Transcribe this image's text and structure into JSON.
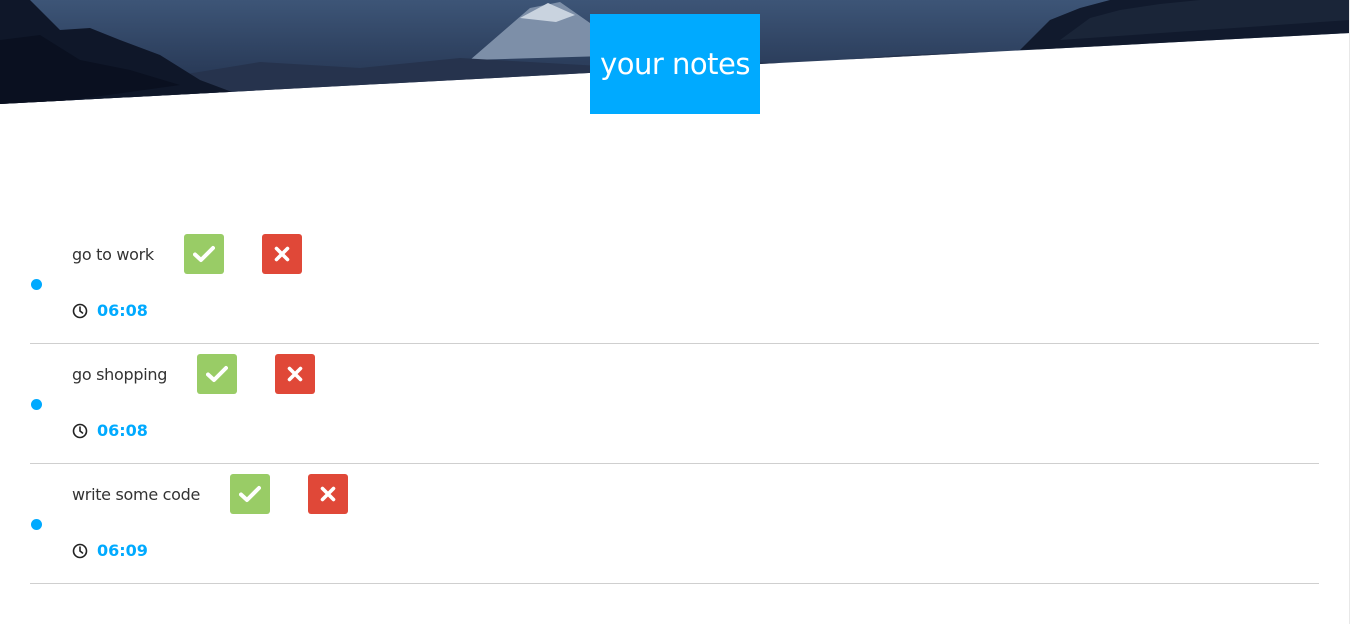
{
  "header": {
    "title": "your notes",
    "title_bg": "#00aaff",
    "background_image": "mountain-landscape"
  },
  "colors": {
    "accent": "#00aaff",
    "done": "#99cc66",
    "delete": "#e04838",
    "divider": "#cfcfcf",
    "text": "#333333"
  },
  "notes": [
    {
      "text": "go to work",
      "time": "06:08",
      "done_icon": "check-icon",
      "delete_icon": "close-icon",
      "time_icon": "clock-icon"
    },
    {
      "text": "go shopping",
      "time": "06:08",
      "done_icon": "check-icon",
      "delete_icon": "close-icon",
      "time_icon": "clock-icon"
    },
    {
      "text": "write some code",
      "time": "06:09",
      "done_icon": "check-icon",
      "delete_icon": "close-icon",
      "time_icon": "clock-icon"
    }
  ]
}
